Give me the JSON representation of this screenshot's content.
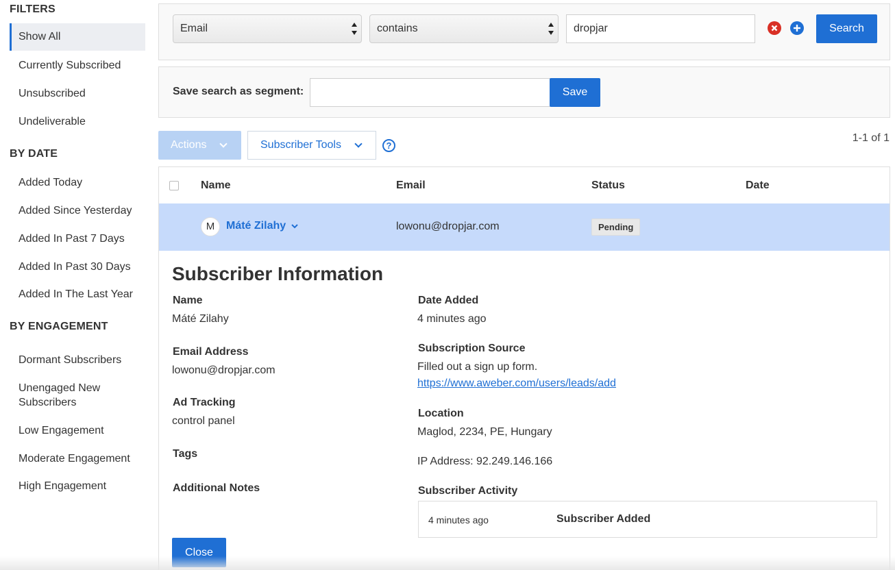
{
  "sidebar": {
    "filters_heading": "FILTERS",
    "filters": [
      "Show All",
      "Currently Subscribed",
      "Unsubscribed",
      "Undeliverable"
    ],
    "by_date_heading": "BY DATE",
    "by_date": [
      "Added Today",
      "Added Since Yesterday",
      "Added In Past 7 Days",
      "Added In Past 30 Days",
      "Added In The Last Year"
    ],
    "by_engagement_heading": "BY ENGAGEMENT",
    "by_engagement": [
      "Dormant Subscribers",
      "Unengaged New Subscribers",
      "Low Engagement",
      "Moderate Engagement",
      "High Engagement"
    ]
  },
  "search": {
    "field_select": "Email",
    "operator_select": "contains",
    "query_value": "dropjar",
    "remove_icon": "x-circle-icon",
    "add_icon": "plus-circle-icon",
    "search_label": "Search"
  },
  "segment": {
    "label": "Save search as segment:",
    "input_value": "",
    "save_label": "Save"
  },
  "toolbar": {
    "actions_label": "Actions",
    "tools_label": "Subscriber Tools",
    "help_glyph": "?",
    "pagination": "1-1 of 1"
  },
  "table": {
    "columns": [
      "Name",
      "Email",
      "Status",
      "Date"
    ],
    "rows": [
      {
        "avatar_initial": "M",
        "name": "Máté Zilahy",
        "email": "lowonu@dropjar.com",
        "status": "Pending",
        "date": ""
      }
    ]
  },
  "detail": {
    "title": "Subscriber Information",
    "name_label": "Name",
    "name_value": "Máté Zilahy",
    "email_label": "Email Address",
    "email_value": "lowonu@dropjar.com",
    "ad_tracking_label": "Ad Tracking",
    "ad_tracking_value": "control panel",
    "tags_label": "Tags",
    "notes_label": "Additional Notes",
    "date_added_label": "Date Added",
    "date_added_value": "4 minutes ago",
    "source_label": "Subscription Source",
    "source_value": "Filled out a sign up form.",
    "source_link": "https://www.aweber.com/users/leads/add",
    "location_label": "Location",
    "location_value": "Maglod, 2234, PE, Hungary",
    "ip_value": "IP Address: 92.249.146.166",
    "activity_label": "Subscriber Activity",
    "activity": [
      {
        "time": "4 minutes ago",
        "event": "Subscriber Added"
      }
    ],
    "close_label": "Close"
  },
  "colors": {
    "accent": "#1f6fd4",
    "selected_row": "#c6dafb",
    "remove_icon": "#d93025"
  }
}
